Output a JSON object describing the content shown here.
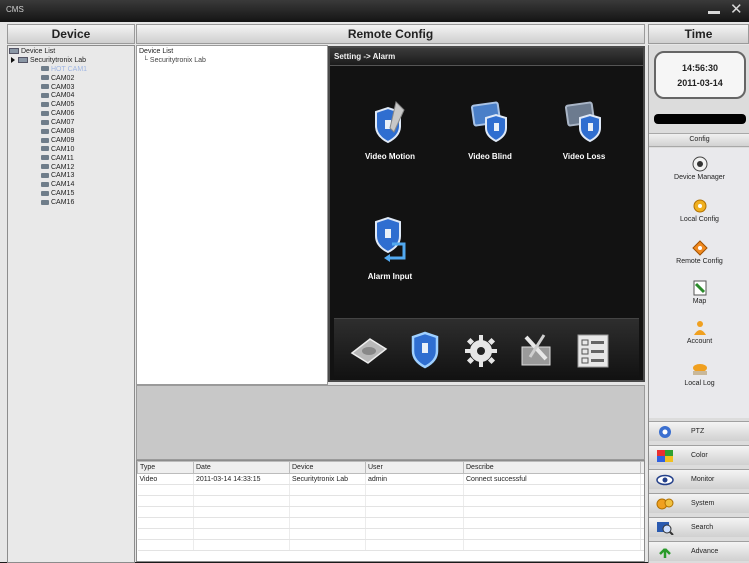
{
  "window": {
    "title": "CMS"
  },
  "headers": {
    "device": "Device",
    "remote_config": "Remote Config",
    "time": "Time"
  },
  "device_tree": {
    "root": "Device List",
    "group": "Securitytronix Lab",
    "cameras": [
      "HOT CAM1",
      "CAM02",
      "CAM03",
      "CAM04",
      "CAM05",
      "CAM06",
      "CAM07",
      "CAM08",
      "CAM09",
      "CAM10",
      "CAM11",
      "CAM12",
      "CAM13",
      "CAM14",
      "CAM15",
      "CAM16"
    ]
  },
  "remote_config": {
    "tree_root": "Device List",
    "tree_child": "Securitytronix Lab",
    "breadcrumb": "Setting -> Alarm",
    "items": [
      "Video Motion",
      "Video Blind",
      "Video Loss",
      "Alarm Input"
    ]
  },
  "log": {
    "columns": [
      "Type",
      "Date",
      "Device",
      "User",
      "Describe"
    ],
    "rows": [
      {
        "type": "Video",
        "date": "2011-03-14 14:33:15",
        "device": "Securitytronix Lab",
        "user": "admin",
        "describe": "Connect successful"
      }
    ]
  },
  "clock": {
    "time": "14:56:30",
    "date": "2011-03-14"
  },
  "config": {
    "header": "Config",
    "items": [
      "Device Manager",
      "Local Config",
      "Remote Config",
      "Map",
      "Account",
      "Local Log"
    ]
  },
  "modules": [
    "PTZ",
    "Color",
    "Monitor",
    "System",
    "Search",
    "Advance"
  ]
}
